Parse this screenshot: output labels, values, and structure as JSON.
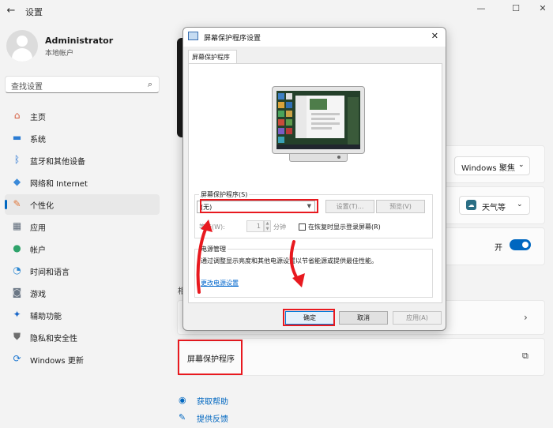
{
  "window": {
    "back": "←",
    "title": "设置",
    "minimize": "—",
    "maximize": "☐",
    "close": "✕"
  },
  "user": {
    "name": "Administrator",
    "account_type": "本地帐户"
  },
  "search": {
    "placeholder": "查找设置",
    "icon": "search-icon"
  },
  "nav": [
    {
      "label": "主页",
      "icon": "home-icon",
      "glyph": "⌂",
      "color": "#d4593a"
    },
    {
      "label": "系统",
      "icon": "monitor-icon",
      "glyph": "▬",
      "color": "#2b7cd3"
    },
    {
      "label": "蓝牙和其他设备",
      "icon": "bluetooth-icon",
      "glyph": "ᛒ",
      "color": "#1f6fd0"
    },
    {
      "label": "网络和 Internet",
      "icon": "wifi-icon",
      "glyph": "◆",
      "color": "#3b8ad9"
    },
    {
      "label": "个性化",
      "icon": "brush-icon",
      "glyph": "✎",
      "color": "#e0783c"
    },
    {
      "label": "应用",
      "icon": "apps-icon",
      "glyph": "▦",
      "color": "#5f6b7a"
    },
    {
      "label": "帐户",
      "icon": "person-icon",
      "glyph": "●",
      "color": "#2fa36b"
    },
    {
      "label": "时间和语言",
      "icon": "globe-clock-icon",
      "glyph": "◔",
      "color": "#2a86d1"
    },
    {
      "label": "游戏",
      "icon": "gamepad-icon",
      "glyph": "◙",
      "color": "#6b7785"
    },
    {
      "label": "辅助功能",
      "icon": "accessibility-icon",
      "glyph": "✦",
      "color": "#1c68c9"
    },
    {
      "label": "隐私和安全性",
      "icon": "shield-icon",
      "glyph": "⛊",
      "color": "#6d6d6d"
    },
    {
      "label": "Windows 更新",
      "icon": "update-icon",
      "glyph": "⟳",
      "color": "#1f78d1"
    }
  ],
  "main": {
    "lockscreen_dropdown": "Windows 聚焦",
    "status_dropdown": "天气等",
    "toggle_label": "开",
    "toggle_on": true,
    "section_fragment": "相",
    "screensaver_link": "屏幕保护程序",
    "help": "获取帮助",
    "feedback": "提供反馈"
  },
  "dialog": {
    "title": "屏幕保护程序设置",
    "tab": "屏幕保护程序",
    "group_label": "屏幕保护程序(S)",
    "selected": "(无)",
    "settings_btn": "设置(T)...",
    "preview_btn": "预览(V)",
    "wait_label": "等待(W):",
    "wait_value": "1",
    "minutes": "分钟",
    "resume_checkbox": "在恢复时显示登录屏幕(R)",
    "power_label": "电源管理",
    "power_desc": "通过调整显示亮度和其他电源设置以节省能源或提供最佳性能。",
    "power_link": "更改电源设置",
    "ok": "确定",
    "cancel": "取消",
    "apply": "应用(A)"
  },
  "accent": "#0067c0",
  "highlight": "#e8191f"
}
